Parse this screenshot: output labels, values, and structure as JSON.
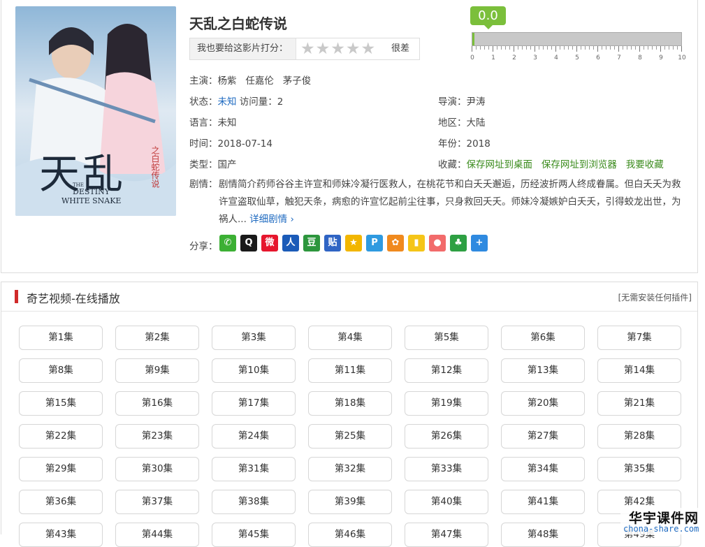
{
  "movie": {
    "title": "天乱之白蛇传说",
    "poster": {
      "big_text": "天乱",
      "en_line1": "THE",
      "en_line2": "DESTINY",
      "en_line3": "WHITE SNAKE",
      "side_text": "之白蛇传说"
    },
    "rate_prompt": "我也要给这影片打分：",
    "rate_word": "很差",
    "score": "0.0",
    "score_fraction": 0.0,
    "scale_ticks": [
      "0",
      "1",
      "2",
      "3",
      "4",
      "5",
      "6",
      "7",
      "8",
      "9",
      "10"
    ],
    "cast_label": "主演：",
    "cast": [
      "杨紫",
      "任嘉伦",
      "茅子俊"
    ],
    "status_label": "状态：",
    "status_value": "未知",
    "visits_label": "访问量：",
    "visits_value": "2",
    "director_label": "导演：",
    "director_value": "尹涛",
    "language_label": "语言：",
    "language_value": "未知",
    "region_label": "地区：",
    "region_value": "大陆",
    "time_label": "时间：",
    "time_value": "2018-07-14",
    "year_label": "年份：",
    "year_value": "2018",
    "type_label": "类型：",
    "type_value": "国产",
    "fav_label": "收藏：",
    "fav_links": [
      "保存网址到桌面",
      "保存网址到浏览器",
      "我要收藏"
    ],
    "plot_label": "剧情：",
    "plot_text": "剧情简介药师谷谷主许宣和师妹冷凝行医救人，在桃花节和白夭夭邂逅，历经波折两人终成眷属。但白夭夭为救许宣盗取仙草，触犯天条，病愈的许宣忆起前尘往事，只身救回夭夭。师妹冷凝嫉妒白夭夭，引得蛟龙出世，为祸人...",
    "plot_more": "详细剧情 ›",
    "share_label": "分享："
  },
  "share_icons": [
    {
      "name": "wechat-icon",
      "glyph": "✆",
      "color": "#3cb034"
    },
    {
      "name": "qq-icon",
      "glyph": "Q",
      "color": "#1a1a1a"
    },
    {
      "name": "weibo-icon",
      "glyph": "微",
      "color": "#e6162d"
    },
    {
      "name": "renren-icon",
      "glyph": "人",
      "color": "#1b5bb8"
    },
    {
      "name": "douban-icon",
      "glyph": "豆",
      "color": "#2d963d"
    },
    {
      "name": "tieba-icon",
      "glyph": "贴",
      "color": "#2f64c4"
    },
    {
      "name": "qzone-icon",
      "glyph": "★",
      "color": "#f2b600"
    },
    {
      "name": "pengyou-icon",
      "glyph": "P",
      "color": "#2f9ae0"
    },
    {
      "name": "kaixin-icon",
      "glyph": "✿",
      "color": "#f08a1e"
    },
    {
      "name": "bookmark-icon",
      "glyph": "▮",
      "color": "#f5c518"
    },
    {
      "name": "gift-icon",
      "glyph": "●",
      "color": "#f26b6b"
    },
    {
      "name": "clover-icon",
      "glyph": "♣",
      "color": "#2ea043"
    },
    {
      "name": "more-share-icon",
      "glyph": "+",
      "color": "#2f8ae0"
    }
  ],
  "player": {
    "title": "奇艺视频-在线播放",
    "note": "[无需安装任何插件]"
  },
  "episodes": [
    "第1集",
    "第2集",
    "第3集",
    "第4集",
    "第5集",
    "第6集",
    "第7集",
    "第8集",
    "第9集",
    "第10集",
    "第11集",
    "第12集",
    "第13集",
    "第14集",
    "第15集",
    "第16集",
    "第17集",
    "第18集",
    "第19集",
    "第20集",
    "第21集",
    "第22集",
    "第23集",
    "第24集",
    "第25集",
    "第26集",
    "第27集",
    "第28集",
    "第29集",
    "第30集",
    "第31集",
    "第32集",
    "第33集",
    "第34集",
    "第35集",
    "第36集",
    "第37集",
    "第38集",
    "第39集",
    "第40集",
    "第41集",
    "第42集",
    "第43集",
    "第44集",
    "第45集",
    "第46集",
    "第47集",
    "第48集",
    "第49集"
  ],
  "watermark": {
    "line1": "华宇课件网",
    "line2": "chona-share.com"
  }
}
